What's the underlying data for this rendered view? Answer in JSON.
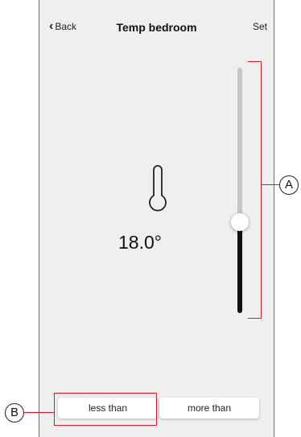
{
  "header": {
    "back_label": "Back",
    "title": "Temp bedroom",
    "set_label": "Set"
  },
  "reading": {
    "icon": "thermometer-icon",
    "value": "18.0°"
  },
  "slider": {
    "level_fraction": 0.34
  },
  "buttons": {
    "less_label": "less than",
    "more_label": "more than"
  },
  "annotations": {
    "a_label": "A",
    "b_label": "B",
    "color": "#d21a2e"
  }
}
